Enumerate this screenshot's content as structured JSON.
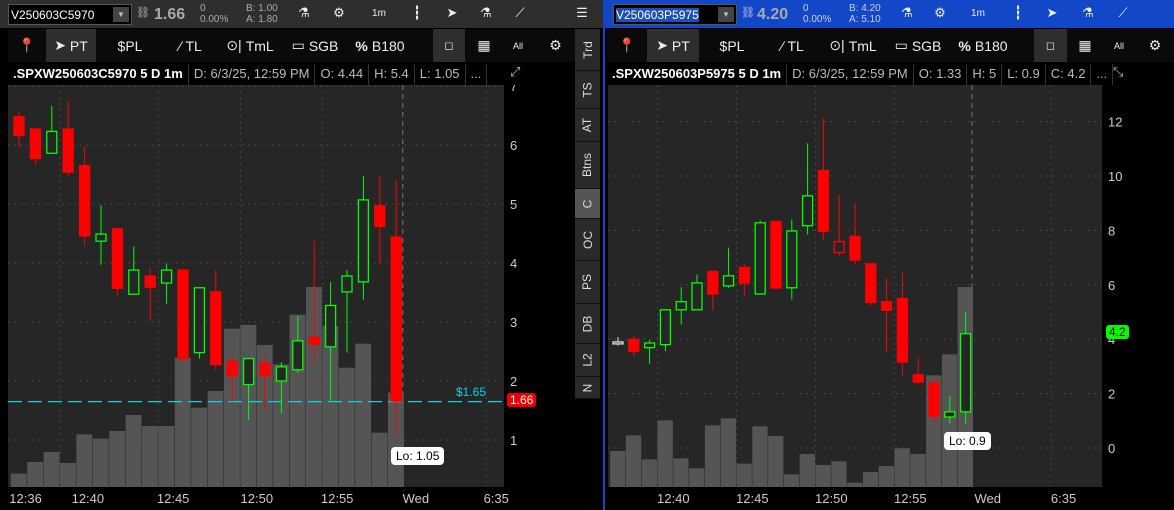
{
  "left": {
    "symbol": "V250603C5970",
    "last": "1.66",
    "change": "0",
    "change_pct": "0.00%",
    "bid": "B: 1.00",
    "ask": "A: 1.80",
    "interval_label": "1m",
    "tools": {
      "pt": "PT",
      "spl": "$PL",
      "tl": "TL",
      "tml": "TmL",
      "sgb": "SGB",
      "b180": "B180",
      "all": "All"
    },
    "info": {
      "title": ".SPXW250603C5970 5 D 1m",
      "date": "D: 6/3/25, 12:59 PM",
      "open": "O: 4.44",
      "high": "H: 5.4",
      "low": "L: 1.05",
      "more": "..."
    },
    "lo_tip": "Lo: 1.05",
    "price_tag": "1.66",
    "alert_label": "$1.65"
  },
  "right": {
    "symbol": "V250603P5975",
    "last": "4.20",
    "change": "0",
    "change_pct": "0.00%",
    "bid": "B: 4.20",
    "ask": "A: 5.10",
    "interval_label": "1m",
    "tools": {
      "pt": "PT",
      "spl": "$PL",
      "tl": "TL",
      "tml": "TmL",
      "sgb": "SGB",
      "b180": "B180",
      "all": "All"
    },
    "info": {
      "title": ".SPXW250603P5975 5 D 1m",
      "date": "D: 6/3/25, 12:59 PM",
      "open": "O: 1.33",
      "high": "H: 5",
      "low": "L: 0.9",
      "close": "C: 4.2",
      "more": "..."
    },
    "lo_tip": "Lo: 0.9",
    "price_tag": "4.2"
  },
  "tabs": [
    "Trd",
    "TS",
    "AT",
    "Btns",
    "C",
    "OC",
    "PS",
    "DB",
    "L2",
    "N"
  ],
  "selected_tab": "C",
  "colors": {
    "up": "#00ff00",
    "down": "#ff0000",
    "volume": "#555555",
    "alert_line": "#00d8e8",
    "right_header": "#1248c8"
  },
  "chart_data": [
    {
      "type": "candlestick",
      "title": ".SPXW250603C5970 5 D 1m",
      "ylim": [
        0.2,
        7
      ],
      "yticks": [
        1,
        2,
        3,
        4,
        5,
        6,
        7
      ],
      "xlabels": [
        {
          "label": "12:36",
          "x": 0.4
        },
        {
          "label": "12:40",
          "x": 4.2
        },
        {
          "label": "12:45",
          "x": 9.4
        },
        {
          "label": "12:50",
          "x": 14.5
        },
        {
          "label": "12:55",
          "x": 19.4
        },
        {
          "label": "Wed",
          "x": 24.2
        },
        {
          "label": "6:35",
          "x": 29.1
        }
      ],
      "alert_level": 1.65,
      "candles": [
        [
          6.48,
          6.58,
          5.96,
          6.16
        ],
        [
          6.27,
          6.27,
          5.66,
          5.77
        ],
        [
          5.86,
          6.66,
          5.86,
          6.23
        ],
        [
          6.27,
          6.73,
          5.47,
          5.54
        ],
        [
          5.65,
          5.97,
          4.3,
          4.46
        ],
        [
          4.37,
          4.98,
          3.97,
          4.49
        ],
        [
          4.58,
          4.58,
          3.45,
          3.57
        ],
        [
          3.47,
          4.28,
          3.47,
          3.88
        ],
        [
          3.78,
          3.91,
          3.02,
          3.59
        ],
        [
          3.66,
          3.99,
          3.31,
          3.88
        ],
        [
          3.88,
          3.88,
          2.32,
          2.38
        ],
        [
          2.48,
          3.58,
          2.38,
          3.58
        ],
        [
          3.51,
          3.88,
          2.18,
          2.28
        ],
        [
          2.33,
          2.44,
          1.65,
          2.09
        ],
        [
          1.94,
          2.38,
          1.34,
          2.38
        ],
        [
          2.3,
          2.44,
          1.54,
          2.09
        ],
        [
          2.0,
          2.32,
          1.45,
          2.24
        ],
        [
          2.19,
          3.1,
          2.14,
          2.68
        ],
        [
          2.74,
          4.38,
          2.32,
          2.62
        ],
        [
          2.58,
          3.68,
          1.65,
          3.28
        ],
        [
          3.51,
          3.88,
          2.48,
          3.78
        ],
        [
          3.68,
          5.48,
          3.38,
          5.07
        ],
        [
          4.97,
          5.48,
          3.97,
          4.62
        ],
        [
          4.44,
          5.4,
          1.05,
          1.66
        ]
      ],
      "volume": [
        40,
        75,
        105,
        72,
        158,
        145,
        168,
        216,
        183,
        183,
        388,
        238,
        288,
        475,
        486,
        426,
        368,
        517,
        600,
        483,
        358,
        430,
        163,
        283
      ]
    },
    {
      "type": "candlestick",
      "title": ".SPXW250603P5975 5 D 1m",
      "ylim": [
        -1.4,
        13.3
      ],
      "yticks": [
        0,
        2,
        4,
        6,
        8,
        10,
        12
      ],
      "xlabels": [
        {
          "label": "12:40",
          "x": 3.5
        },
        {
          "label": "12:45",
          "x": 8.5
        },
        {
          "label": "12:50",
          "x": 13.5
        },
        {
          "label": "12:55",
          "x": 18.5
        },
        {
          "label": "Wed",
          "x": 23.4
        },
        {
          "label": "6:35",
          "x": 28.2
        }
      ],
      "candles": [
        [
          3.9,
          4.08,
          3.77,
          3.85
        ],
        [
          3.99,
          4.11,
          3.34,
          3.56
        ],
        [
          3.69,
          3.98,
          3.1,
          3.86
        ],
        [
          3.8,
          5.08,
          3.56,
          5.08
        ],
        [
          5.08,
          5.91,
          4.54,
          5.38
        ],
        [
          5.08,
          6.38,
          5.08,
          6.07
        ],
        [
          6.49,
          6.49,
          5.06,
          5.66
        ],
        [
          5.96,
          7.37,
          5.89,
          6.33
        ],
        [
          6.64,
          6.77,
          5.58,
          6.06
        ],
        [
          5.66,
          8.36,
          5.66,
          8.28
        ],
        [
          8.33,
          8.33,
          5.88,
          5.88
        ],
        [
          5.89,
          8.4,
          5.46,
          7.98
        ],
        [
          8.17,
          11.2,
          7.85,
          9.27
        ],
        [
          10.2,
          12.12,
          7.67,
          7.97
        ],
        [
          7.59,
          9.31,
          7.05,
          7.18
        ],
        [
          7.78,
          9.01,
          6.76,
          6.91
        ],
        [
          6.77,
          6.77,
          5.24,
          5.35
        ],
        [
          5.38,
          6.24,
          3.53,
          5.06
        ],
        [
          5.5,
          6.44,
          2.67,
          3.16
        ],
        [
          2.69,
          3.32,
          2.34,
          2.42
        ],
        [
          2.39,
          2.57,
          0.93,
          1.16
        ],
        [
          1.14,
          1.91,
          0.9,
          1.33
        ],
        [
          1.33,
          5.0,
          0.9,
          4.2
        ]
      ],
      "volume": [
        108,
        155,
        83,
        200,
        86,
        56,
        185,
        206,
        70,
        182,
        153,
        38,
        99,
        66,
        77,
        13,
        45,
        63,
        116,
        99,
        335,
        398,
        600
      ]
    }
  ]
}
